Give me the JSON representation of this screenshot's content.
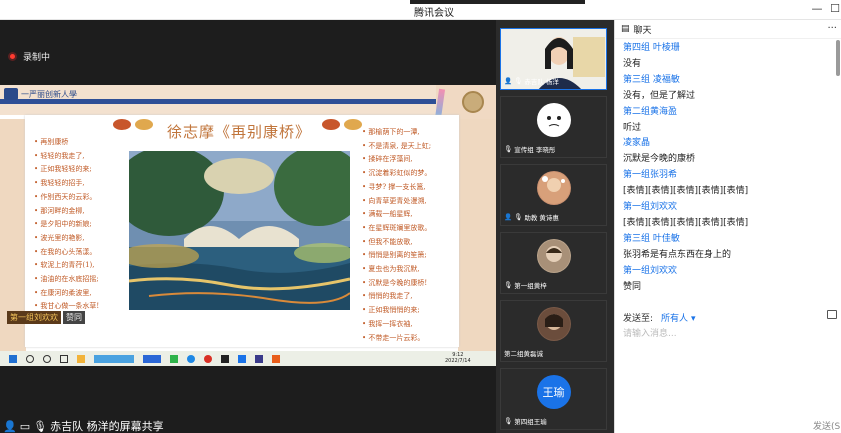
{
  "window": {
    "title": "腾讯会议"
  },
  "recording": {
    "label": "录制中"
  },
  "slide": {
    "school_name": "一严丽创新人學",
    "title": "徐志摩《再别康桥》",
    "poem_left": [
      "再别康桥",
      "轻轻的我走了,",
      "正如我轻轻的来;",
      "我轻轻的招手,",
      "作别西天的云彩。",
      "那河畔的金柳,",
      "是夕阳中的新娘;",
      "波光里的艳影,",
      "在我的心头荡漾。",
      "软泥上的青荇(1),",
      "油油的在水底招摇;",
      "在康河的柔波里,",
      "我甘心做一条水草!"
    ],
    "poem_right": [
      "那榆荫下的一潭,",
      "不是清泉, 是天上虹;",
      "揉碎在浮藻间,",
      "沉淀着彩虹似的梦。",
      "寻梦? 撑一支长篙,",
      "向青草更青处漫溯,",
      "满载一船星辉,",
      "在星辉斑斓里放歌。",
      "但我不能放歌,",
      "悄悄是别离的笙箫;",
      "夏虫也为我沉默,",
      "沉默是今晚的康桥!",
      "悄悄的我走了,",
      "正如我悄悄的来;",
      "我挥一挥衣袖,",
      "不带走一片云彩。"
    ],
    "speaker_tag": "第一组刘欢欢",
    "speaker_tag2": "赞同"
  },
  "taskbar": {
    "time": "9:12",
    "date": "2022/7/14"
  },
  "share_label": "赤吉队 杨洋的屏幕共享",
  "participants": [
    {
      "name": "赤吉队 杨洋"
    },
    {
      "name": "宣传组 李晓彤"
    },
    {
      "name": "助教 黄诗惠"
    },
    {
      "name": "第一组黄梓"
    },
    {
      "name": "第二组黄磊诚"
    },
    {
      "name": "第四组王瑜",
      "initials": "王瑜"
    }
  ],
  "chat": {
    "header": "聊天",
    "more": "···",
    "messages": [
      {
        "type": "s",
        "text": "第四组 叶棱珊"
      },
      {
        "type": "m",
        "text": "没有"
      },
      {
        "type": "s",
        "text": "第三组 凌福敏"
      },
      {
        "type": "m",
        "text": "没有，但是了解过"
      },
      {
        "type": "s",
        "text": "第二组黄海盈"
      },
      {
        "type": "m",
        "text": "听过"
      },
      {
        "type": "s",
        "text": "凌家晶"
      },
      {
        "type": "m",
        "text": "沉默是今晚的康桥"
      },
      {
        "type": "s",
        "text": "第一组张羽希"
      },
      {
        "type": "m",
        "text": "[表情][表情][表情][表情][表情]"
      },
      {
        "type": "s",
        "text": "第一组刘欢欢"
      },
      {
        "type": "m",
        "text": "[表情][表情][表情][表情][表情]"
      },
      {
        "type": "s",
        "text": "第三组 叶佳敏"
      },
      {
        "type": "m",
        "text": "张羽希是有点东西在身上的"
      },
      {
        "type": "s",
        "text": "第一组刘欢欢"
      },
      {
        "type": "m",
        "text": "赞同"
      }
    ],
    "send_to_label": "发送至:",
    "send_to_value": "所有人",
    "input_placeholder": "请输入消息...",
    "send_button": "发送(S"
  },
  "colors": {
    "accent": "#1a73e8",
    "title_orange": "#c1753b",
    "poem": "#c05a26"
  }
}
